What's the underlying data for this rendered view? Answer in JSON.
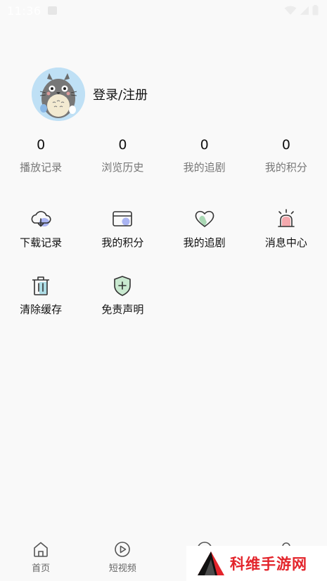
{
  "status_bar": {
    "time": "11:36"
  },
  "profile": {
    "login_label": "登录/注册"
  },
  "stats": [
    {
      "value": "0",
      "label": "播放记录"
    },
    {
      "value": "0",
      "label": "浏览历史"
    },
    {
      "value": "0",
      "label": "我的追剧"
    },
    {
      "value": "0",
      "label": "我的积分"
    }
  ],
  "menu": [
    {
      "label": "下载记录",
      "icon": "cloud-download-icon"
    },
    {
      "label": "我的积分",
      "icon": "card-icon"
    },
    {
      "label": "我的追剧",
      "icon": "heart-icon"
    },
    {
      "label": "消息中心",
      "icon": "alarm-icon"
    },
    {
      "label": "清除缓存",
      "icon": "trash-icon"
    },
    {
      "label": "免责声明",
      "icon": "shield-icon"
    }
  ],
  "tabbar": [
    {
      "label": "首页",
      "icon": "home-icon"
    },
    {
      "label": "短视频",
      "icon": "play-circle-icon"
    },
    {
      "label": "",
      "icon": "circle-icon"
    },
    {
      "label": "",
      "icon": "user-icon"
    }
  ],
  "watermark": {
    "text": "科维手游网"
  }
}
